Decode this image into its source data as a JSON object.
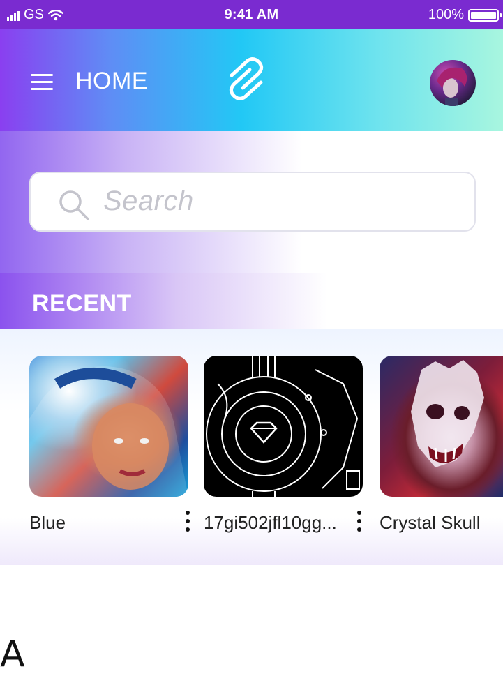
{
  "status_bar": {
    "carrier": "GS",
    "time": "9:41 AM",
    "battery": "100%",
    "battery_level": 1.0,
    "icons": [
      "signal-icon",
      "wifi-icon",
      "battery-icon"
    ]
  },
  "header": {
    "title": "HOME",
    "menu_icon": "menu-icon",
    "logo_icon": "logo-icon",
    "avatar_icon": "avatar"
  },
  "search": {
    "placeholder": "Search",
    "icon": "search-icon"
  },
  "recent": {
    "title": "RECENT",
    "items": [
      {
        "label": "Blue"
      },
      {
        "label": "17gi502jfl10gg..."
      },
      {
        "label": "Crystal Skull"
      }
    ]
  },
  "footer": {
    "letter": "A"
  },
  "colors": {
    "status_bar_bg": "#7a2bd0",
    "header_gradient_start": "#8a3ff0",
    "header_gradient_mid": "#22c8f5",
    "header_gradient_end": "#a8f6df",
    "text_dark": "#222222",
    "placeholder": "#c4c4cc"
  }
}
